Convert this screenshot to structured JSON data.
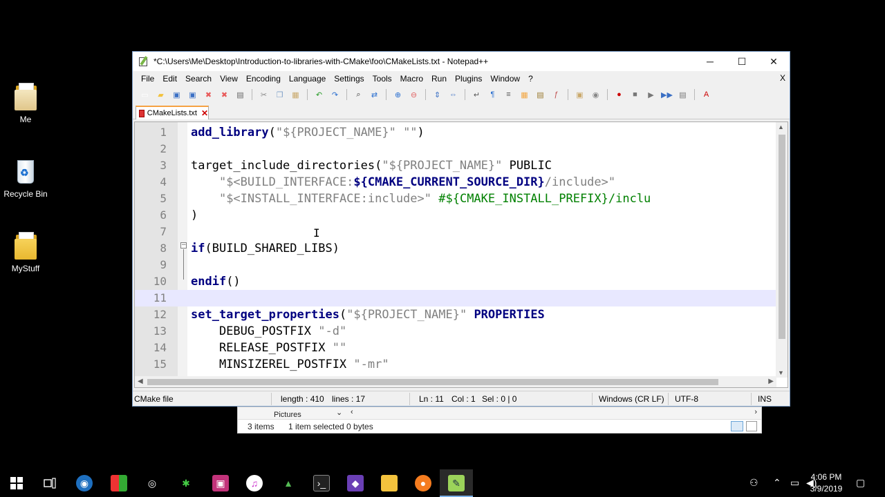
{
  "desktop": {
    "icons": [
      {
        "label": "Me"
      },
      {
        "label": "Recycle Bin"
      },
      {
        "label": "MyStuff"
      }
    ]
  },
  "window": {
    "title": "*C:\\Users\\Me\\Desktop\\Introduction-to-libraries-with-CMake\\foo\\CMakeLists.txt - Notepad++",
    "minimize": "─",
    "maximize": "☐",
    "close": "✕"
  },
  "menu": {
    "items": [
      "File",
      "Edit",
      "Search",
      "View",
      "Encoding",
      "Language",
      "Settings",
      "Tools",
      "Macro",
      "Run",
      "Plugins",
      "Window",
      "?"
    ],
    "close_doc": "X"
  },
  "toolbar": {
    "icons": [
      "new-file-icon",
      "open-file-icon",
      "save-icon",
      "save-all-icon",
      "close-icon",
      "close-all-icon",
      "print-icon",
      "cut-icon",
      "copy-icon",
      "paste-icon",
      "undo-icon",
      "redo-icon",
      "find-icon",
      "replace-icon",
      "zoom-in-icon",
      "zoom-out-icon",
      "sync-v-icon",
      "sync-h-icon",
      "word-wrap-icon",
      "show-all-chars-icon",
      "indent-guide-icon",
      "language-icon",
      "doc-map-icon",
      "function-list-icon",
      "folder-workspace-icon",
      "monitoring-icon",
      "record-macro-icon",
      "stop-macro-icon",
      "play-macro-icon",
      "run-macro-multiple-icon",
      "save-macro-icon",
      "spell-check-icon"
    ]
  },
  "tab": {
    "label": "CMakeLists.txt",
    "close": "✕"
  },
  "editor": {
    "lines": [
      {
        "n": "1",
        "parts": [
          [
            "kw",
            "add_library"
          ],
          [
            "",
            "("
          ],
          [
            "str",
            "\"${PROJECT_NAME}\" \"\""
          ],
          [
            "",
            ")"
          ]
        ]
      },
      {
        "n": "2",
        "parts": []
      },
      {
        "n": "3",
        "parts": [
          [
            "",
            "target_include_directories("
          ],
          [
            "str",
            "\"${PROJECT_NAME}\""
          ],
          [
            "",
            " PUBLIC"
          ]
        ]
      },
      {
        "n": "4",
        "parts": [
          [
            "",
            "    "
          ],
          [
            "gen",
            "\"$<BUILD_INTERFACE:"
          ],
          [
            "var",
            "${CMAKE_CURRENT_SOURCE_DIR}"
          ],
          [
            "gen",
            "/include>\""
          ]
        ]
      },
      {
        "n": "5",
        "parts": [
          [
            "",
            "    "
          ],
          [
            "gen",
            "\"$<INSTALL_INTERFACE:include>\""
          ],
          [
            "",
            " "
          ],
          [
            "cm",
            "#${CMAKE_INSTALL_PREFIX}/inclu"
          ]
        ]
      },
      {
        "n": "6",
        "parts": [
          [
            "",
            ")"
          ]
        ]
      },
      {
        "n": "7",
        "parts": []
      },
      {
        "n": "8",
        "parts": [
          [
            "kw",
            "if"
          ],
          [
            "",
            "(BUILD_SHARED_LIBS)"
          ]
        ]
      },
      {
        "n": "9",
        "parts": []
      },
      {
        "n": "10",
        "parts": [
          [
            "kw",
            "endif"
          ],
          [
            "",
            "()"
          ]
        ]
      },
      {
        "n": "11",
        "parts": []
      },
      {
        "n": "12",
        "parts": [
          [
            "kw",
            "set_target_properties"
          ],
          [
            "",
            "("
          ],
          [
            "str",
            "\"${PROJECT_NAME}\""
          ],
          [
            "",
            " "
          ],
          [
            "kw",
            "PROPERTIES"
          ]
        ]
      },
      {
        "n": "13",
        "parts": [
          [
            "",
            "    DEBUG_POSTFIX "
          ],
          [
            "str",
            "\"-d\""
          ]
        ]
      },
      {
        "n": "14",
        "parts": [
          [
            "",
            "    RELEASE_POSTFIX "
          ],
          [
            "str",
            "\"\""
          ]
        ]
      },
      {
        "n": "15",
        "parts": [
          [
            "",
            "    MINSIZEREL_POSTFIX "
          ],
          [
            "str",
            "\"-mr\""
          ]
        ]
      }
    ],
    "current_line": "11"
  },
  "status": {
    "file_type": "CMake file",
    "length": "length : 410",
    "lines": "lines : 17",
    "ln": "Ln : 11",
    "col": "Col : 1",
    "sel": "Sel : 0 | 0",
    "eol": "Windows (CR LF)",
    "encoding": "UTF-8",
    "mode": "INS"
  },
  "explorer": {
    "folder": "Pictures",
    "items_count": "3 items",
    "selection": "1 item selected  0 bytes"
  },
  "taskbar": {
    "time": "4:06 PM",
    "date": "3/9/2019"
  }
}
